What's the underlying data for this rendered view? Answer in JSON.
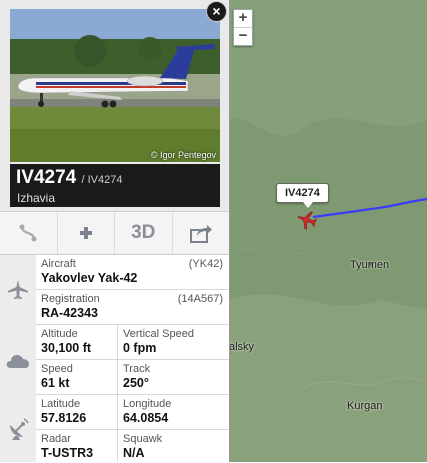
{
  "map": {
    "zoom_in": "+",
    "zoom_out": "−",
    "flight_tag": "IV4274",
    "cities": [
      {
        "name": "Tyumen"
      },
      {
        "name": "Kurgan"
      },
      {
        "name": "alsky"
      }
    ],
    "track_color": "#3b3bff"
  },
  "panel": {
    "photo_credit": "© Igor Pentegov",
    "close_label": "×",
    "callsign": "IV4274",
    "callsign_secondary": "/ IV4274",
    "airline": "Izhavia",
    "action_3d": "3D",
    "aircraft_label": "Aircraft",
    "aircraft_value": "Yakovlev Yak-42",
    "aircraft_code": "(YK42)",
    "registration_label": "Registration",
    "registration_value": "RA-42343",
    "registration_code": "(14A567)",
    "altitude_label": "Altitude",
    "altitude_value": "30,100 ft",
    "vspeed_label": "Vertical Speed",
    "vspeed_value": "0 fpm",
    "speed_label": "Speed",
    "speed_value": "61 kt",
    "track_label": "Track",
    "track_value": "250°",
    "latitude_label": "Latitude",
    "latitude_value": "57.8126",
    "longitude_label": "Longitude",
    "longitude_value": "64.0854",
    "radar_label": "Radar",
    "radar_value": "T-USTR3",
    "squawk_label": "Squawk",
    "squawk_value": "N/A"
  }
}
